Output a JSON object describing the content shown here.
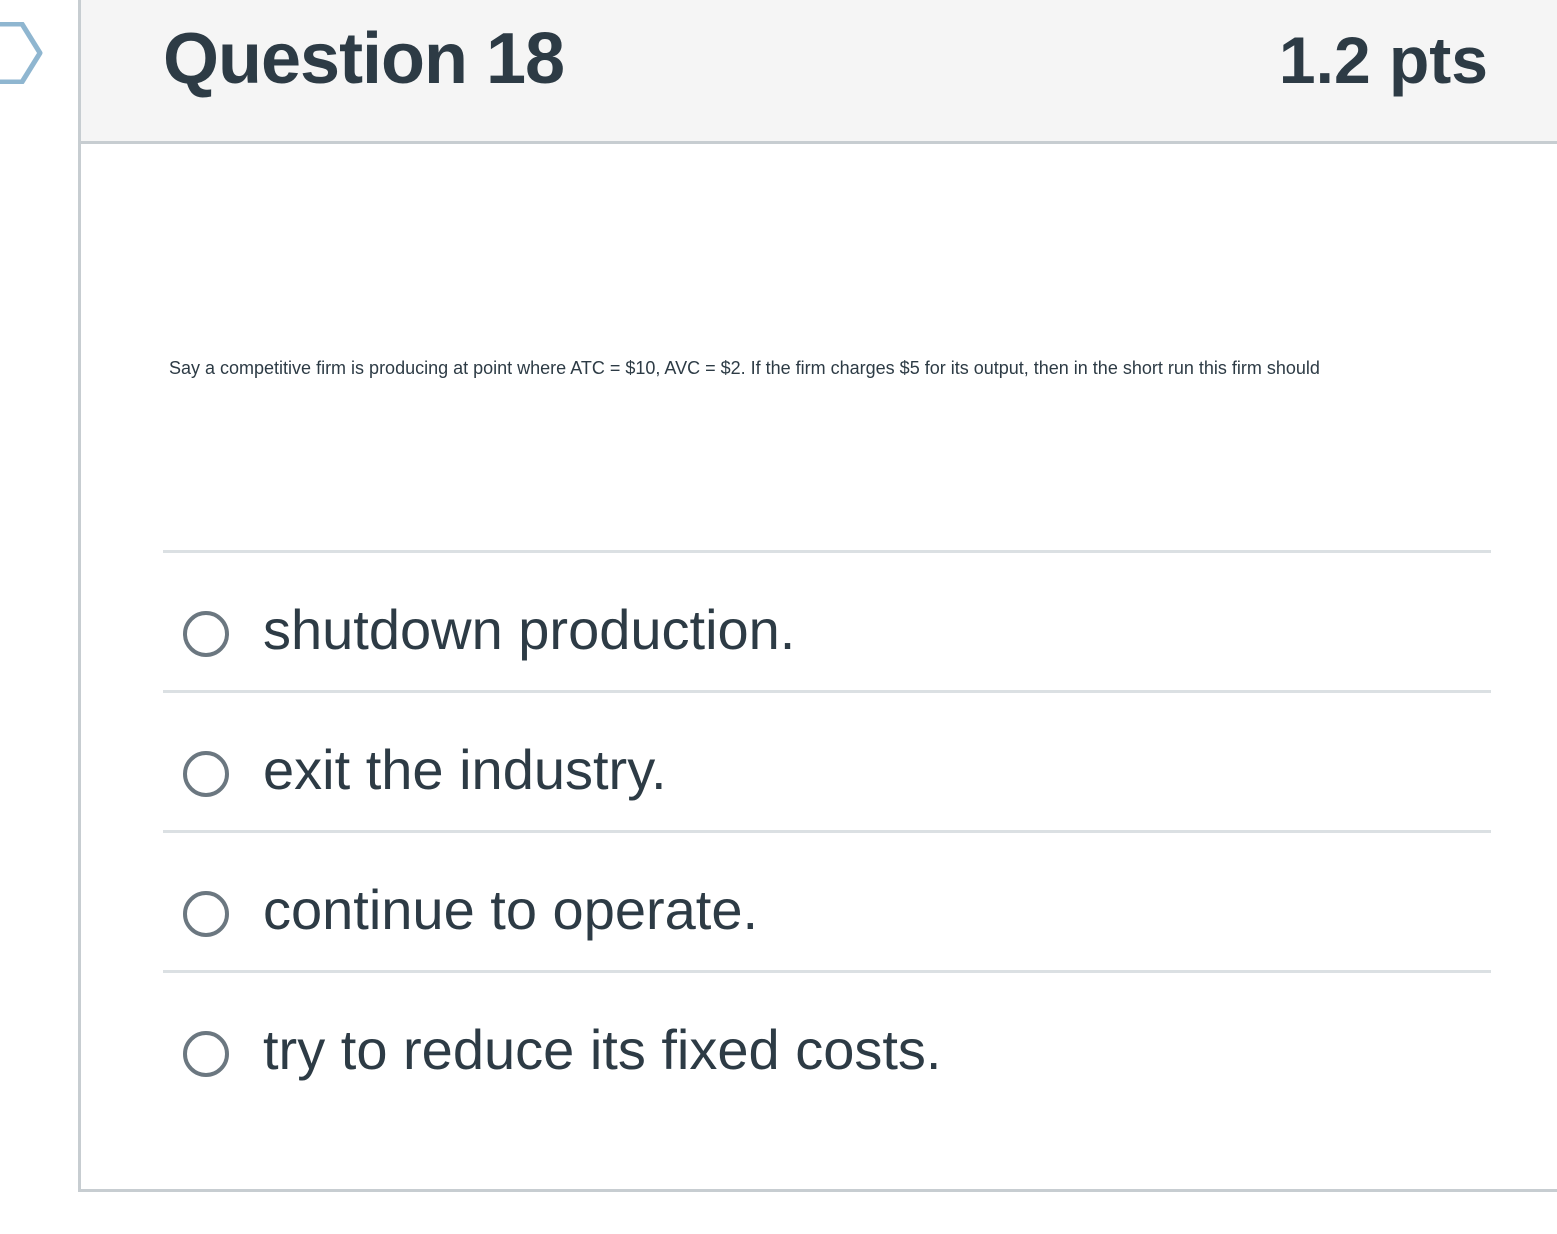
{
  "question": {
    "title": "Question 18",
    "points": "1.2 pts",
    "text": "Say a competitive firm is producing at point where ATC = $10, AVC = $2. If the firm charges $5 for its output, then in the short run this firm should"
  },
  "answers": [
    {
      "label": "shutdown production.",
      "selected": false
    },
    {
      "label": "exit the industry.",
      "selected": false
    },
    {
      "label": "continue to operate.",
      "selected": false
    },
    {
      "label": "try to reduce its fixed costs.",
      "selected": false
    }
  ],
  "colors": {
    "header_bg": "#f5f5f5",
    "border": "#c7cdd1",
    "text": "#2d3b45",
    "flag": "#8fb6d0"
  },
  "icons": {
    "flag": "question-flag-icon",
    "radio": "radio-button-icon"
  }
}
